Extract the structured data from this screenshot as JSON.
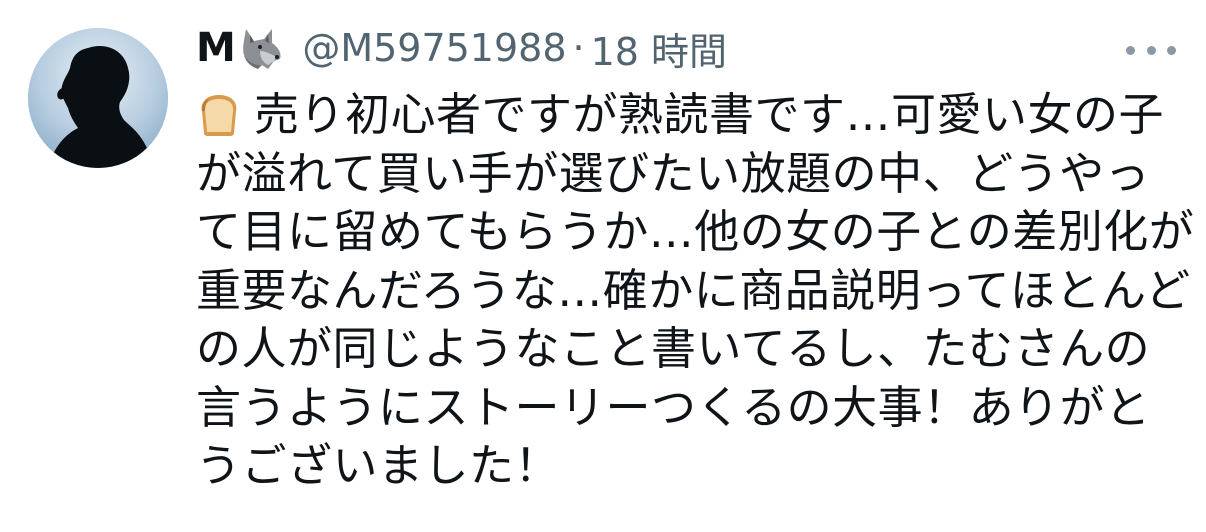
{
  "tweet": {
    "author": {
      "display_name": "M",
      "handle": "@M59751988",
      "name_emoji": "wolf-icon"
    },
    "separator": "·",
    "timestamp": "18 時間",
    "leading_emoji": "bread-icon",
    "text_lines": [
      "売り初心者ですが熟読書です…可愛い女の子",
      "が溢れて買い手が選びたい放題の中、どうやっ",
      "て目に留めてもらうか…他の女の子との差別化が",
      "重要なんだろうな…確かに商品説明ってほとんど",
      "の人が同じようなこと書いてるし、たむさんの",
      "言うようにストーリーつくるの大事！ありがと",
      "うございました！"
    ]
  }
}
